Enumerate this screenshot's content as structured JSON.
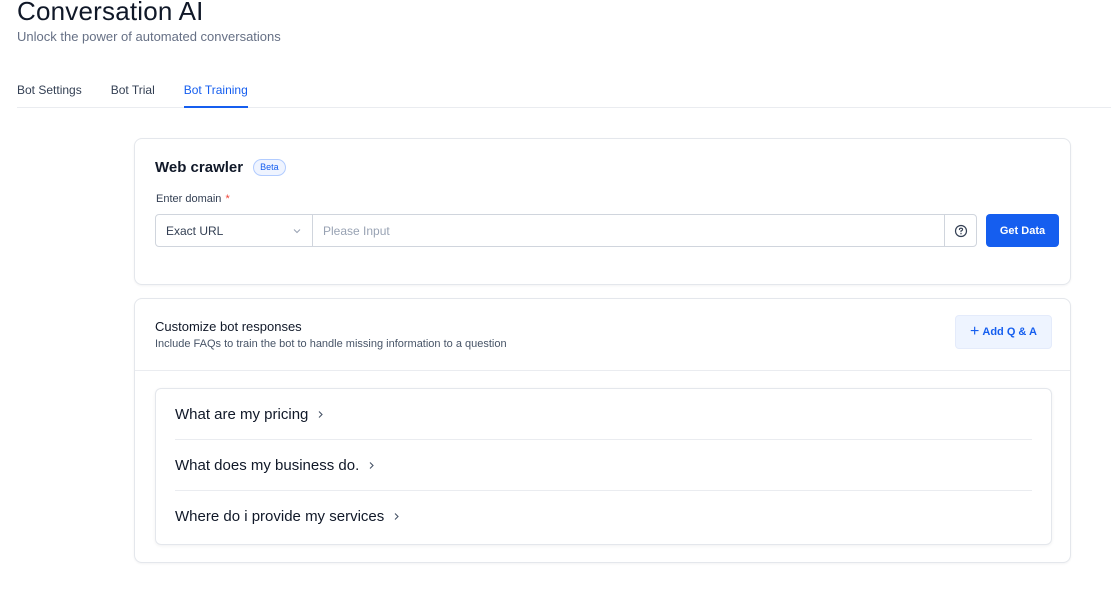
{
  "header": {
    "title": "Conversation AI",
    "subtitle": "Unlock the power of automated conversations"
  },
  "tabs": [
    {
      "label": "Bot Settings",
      "active": false
    },
    {
      "label": "Bot Trial",
      "active": false
    },
    {
      "label": "Bot Training",
      "active": true
    }
  ],
  "crawler": {
    "title": "Web crawler",
    "badge": "Beta",
    "field_label": "Enter domain",
    "required_marker": "*",
    "select_value": "Exact URL",
    "input_placeholder": "Please Input",
    "input_value": "",
    "button_label": "Get Data"
  },
  "responses": {
    "title": "Customize bot responses",
    "description": "Include FAQs to train the bot to handle missing information to a question",
    "add_button_label": "Add Q & A",
    "faqs": [
      {
        "question": "What are my pricing"
      },
      {
        "question": "What does my business do."
      },
      {
        "question": "Where do i provide my services"
      }
    ]
  },
  "colors": {
    "accent": "#155eef",
    "required": "#f04438",
    "border": "#e4e7ec"
  }
}
